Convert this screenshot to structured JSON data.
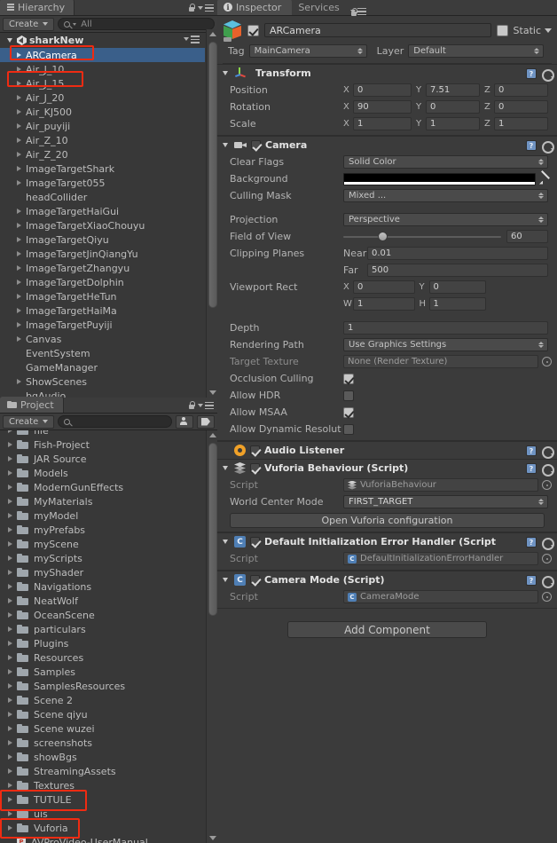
{
  "hierarchy": {
    "tab_label": "Hierarchy",
    "tab_icon": "hierarchy-icon",
    "create_label": "Create",
    "search_placeholder": "All",
    "search_value": "All",
    "scene_name": "sharkNew",
    "items": [
      {
        "label": "ARCamera",
        "expandable": true,
        "selected": true,
        "highlighted": true
      },
      {
        "label": "Air_J_10",
        "expandable": true,
        "selected": false,
        "highlighted": false
      },
      {
        "label": "Air_J_15",
        "expandable": true,
        "selected": false,
        "highlighted": true
      },
      {
        "label": "Air_J_20",
        "expandable": true,
        "selected": false,
        "highlighted": false
      },
      {
        "label": "Air_KJ500",
        "expandable": true,
        "selected": false,
        "highlighted": false
      },
      {
        "label": "Air_puyiji",
        "expandable": true,
        "selected": false,
        "highlighted": false
      },
      {
        "label": "Air_Z_10",
        "expandable": true,
        "selected": false,
        "highlighted": false
      },
      {
        "label": "Air_Z_20",
        "expandable": true,
        "selected": false,
        "highlighted": false
      },
      {
        "label": "ImageTargetShark",
        "expandable": true,
        "selected": false,
        "highlighted": false
      },
      {
        "label": "ImageTarget055",
        "expandable": true,
        "selected": false,
        "highlighted": false
      },
      {
        "label": "headCollider",
        "expandable": false,
        "selected": false,
        "highlighted": false
      },
      {
        "label": "ImageTargetHaiGui",
        "expandable": true,
        "selected": false,
        "highlighted": false
      },
      {
        "label": "ImageTargetXiaoChouyu",
        "expandable": true,
        "selected": false,
        "highlighted": false
      },
      {
        "label": "ImageTargetQiyu",
        "expandable": true,
        "selected": false,
        "highlighted": false
      },
      {
        "label": "ImageTargetJinQiangYu",
        "expandable": true,
        "selected": false,
        "highlighted": false
      },
      {
        "label": "ImageTargetZhangyu",
        "expandable": true,
        "selected": false,
        "highlighted": false
      },
      {
        "label": "ImageTargetDolphin",
        "expandable": true,
        "selected": false,
        "highlighted": false
      },
      {
        "label": "ImageTargetHeTun",
        "expandable": true,
        "selected": false,
        "highlighted": false
      },
      {
        "label": "ImageTargetHaiMa",
        "expandable": true,
        "selected": false,
        "highlighted": false
      },
      {
        "label": "ImageTargetPuyiji",
        "expandable": true,
        "selected": false,
        "highlighted": false
      },
      {
        "label": "Canvas",
        "expandable": true,
        "selected": false,
        "highlighted": false
      },
      {
        "label": "EventSystem",
        "expandable": false,
        "selected": false,
        "highlighted": false
      },
      {
        "label": "GameManager",
        "expandable": false,
        "selected": false,
        "highlighted": false
      },
      {
        "label": "ShowScenes",
        "expandable": true,
        "selected": false,
        "highlighted": false
      },
      {
        "label": "bqAudio",
        "expandable": false,
        "selected": false,
        "highlighted": false
      }
    ]
  },
  "project": {
    "tab_label": "Project",
    "tab_icon": "folder-icon",
    "create_label": "Create",
    "search_placeholder": "",
    "items": [
      {
        "label": "file",
        "icon": "folder-icon",
        "expandable": true,
        "highlighted": false,
        "clipped": true
      },
      {
        "label": "Fish-Project",
        "icon": "folder-icon",
        "expandable": true,
        "highlighted": false
      },
      {
        "label": "JAR Source",
        "icon": "folder-icon",
        "expandable": true,
        "highlighted": false
      },
      {
        "label": "Models",
        "icon": "folder-icon",
        "expandable": true,
        "highlighted": false
      },
      {
        "label": "ModernGunEffects",
        "icon": "folder-icon",
        "expandable": true,
        "highlighted": false
      },
      {
        "label": "MyMaterials",
        "icon": "folder-icon",
        "expandable": true,
        "highlighted": false
      },
      {
        "label": "myModel",
        "icon": "folder-icon",
        "expandable": true,
        "highlighted": false
      },
      {
        "label": "myPrefabs",
        "icon": "folder-icon",
        "expandable": true,
        "highlighted": false
      },
      {
        "label": "myScene",
        "icon": "folder-icon",
        "expandable": true,
        "highlighted": false
      },
      {
        "label": "myScripts",
        "icon": "folder-icon",
        "expandable": true,
        "highlighted": false
      },
      {
        "label": "myShader",
        "icon": "folder-icon",
        "expandable": true,
        "highlighted": false
      },
      {
        "label": "Navigations",
        "icon": "folder-icon",
        "expandable": true,
        "highlighted": false
      },
      {
        "label": "NeatWolf",
        "icon": "folder-icon",
        "expandable": true,
        "highlighted": false
      },
      {
        "label": "OceanScene",
        "icon": "folder-icon",
        "expandable": true,
        "highlighted": false
      },
      {
        "label": "particulars",
        "icon": "folder-icon",
        "expandable": true,
        "highlighted": false
      },
      {
        "label": "Plugins",
        "icon": "folder-icon",
        "expandable": true,
        "highlighted": false
      },
      {
        "label": "Resources",
        "icon": "folder-icon",
        "expandable": true,
        "highlighted": false
      },
      {
        "label": "Samples",
        "icon": "folder-icon",
        "expandable": true,
        "highlighted": false
      },
      {
        "label": "SamplesResources",
        "icon": "folder-icon",
        "expandable": true,
        "highlighted": false
      },
      {
        "label": "Scene 2",
        "icon": "folder-icon",
        "expandable": true,
        "highlighted": false
      },
      {
        "label": "Scene qiyu",
        "icon": "folder-icon",
        "expandable": true,
        "highlighted": false
      },
      {
        "label": "Scene wuzei",
        "icon": "folder-icon",
        "expandable": true,
        "highlighted": false
      },
      {
        "label": "screenshots",
        "icon": "folder-icon",
        "expandable": true,
        "highlighted": false
      },
      {
        "label": "showBgs",
        "icon": "folder-icon",
        "expandable": true,
        "highlighted": false
      },
      {
        "label": "StreamingAssets",
        "icon": "folder-icon",
        "expandable": true,
        "highlighted": false
      },
      {
        "label": "Textures",
        "icon": "folder-icon",
        "expandable": true,
        "highlighted": false
      },
      {
        "label": "TUTULE",
        "icon": "folder-icon",
        "expandable": true,
        "highlighted": true
      },
      {
        "label": "uis",
        "icon": "folder-icon",
        "expandable": true,
        "highlighted": false
      },
      {
        "label": "Vuforia",
        "icon": "folder-icon",
        "expandable": true,
        "highlighted": true
      },
      {
        "label": "AVProVideo-UserManual",
        "icon": "pdf-icon",
        "expandable": false,
        "highlighted": false
      }
    ]
  },
  "inspector": {
    "tabs": [
      {
        "label": "Inspector",
        "active": true,
        "icon": "info-icon"
      },
      {
        "label": "Services",
        "active": false,
        "icon": ""
      }
    ],
    "object": {
      "name": "ARCamera",
      "enabled": true,
      "static_label": "Static",
      "static_checked": false,
      "tag_label": "Tag",
      "tag_value": "MainCamera",
      "layer_label": "Layer",
      "layer_value": "Default"
    },
    "components": [
      {
        "title": "Transform",
        "icon": "transform-axis-icon",
        "has_checkbox": false,
        "rows": [
          {
            "name": "Position",
            "type": "vector3",
            "x": "0",
            "y": "7.51",
            "z": "0"
          },
          {
            "name": "Rotation",
            "type": "vector3",
            "x": "90",
            "y": "0",
            "z": "0"
          },
          {
            "name": "Scale",
            "type": "vector3",
            "x": "1",
            "y": "1",
            "z": "1"
          }
        ]
      },
      {
        "title": "Camera",
        "icon": "camera-icon",
        "has_checkbox": true,
        "checked": true,
        "rows": [
          {
            "name": "Clear Flags",
            "type": "dropdown",
            "value": "Solid Color"
          },
          {
            "name": "Background",
            "type": "color",
            "value": "#000000"
          },
          {
            "name": "Culling Mask",
            "type": "dropdown",
            "value": "Mixed ..."
          },
          {
            "name": "",
            "type": "spacer"
          },
          {
            "name": "Projection",
            "type": "dropdown",
            "value": "Perspective"
          },
          {
            "name": "Field of View",
            "type": "slider",
            "value": "60",
            "percent": 22
          },
          {
            "name": "Clipping Planes",
            "type": "sub",
            "sub_label": "Near",
            "value": "0.01"
          },
          {
            "name": "",
            "type": "sub",
            "sub_label": "Far",
            "value": "500"
          },
          {
            "name": "Viewport Rect",
            "type": "vector2",
            "a_label": "X",
            "a": "0",
            "b_label": "Y",
            "b": "0"
          },
          {
            "name": "",
            "type": "vector2",
            "a_label": "W",
            "a": "1",
            "b_label": "H",
            "b": "1"
          },
          {
            "name": "",
            "type": "spacer"
          },
          {
            "name": "Depth",
            "type": "text",
            "value": "1"
          },
          {
            "name": "Rendering Path",
            "type": "dropdown",
            "value": "Use Graphics Settings"
          },
          {
            "name": "Target Texture",
            "type": "object",
            "value": "None (Render Texture)"
          },
          {
            "name": "Occlusion Culling",
            "type": "checkbox",
            "checked": true
          },
          {
            "name": "Allow HDR",
            "type": "checkbox",
            "checked": false
          },
          {
            "name": "Allow MSAA",
            "type": "checkbox",
            "checked": true
          },
          {
            "name": "Allow Dynamic Resolut",
            "type": "checkbox",
            "checked": false
          }
        ]
      },
      {
        "title": "Audio Listener",
        "icon": "audio-listener-icon",
        "has_checkbox": true,
        "checked": true,
        "collapsed": true,
        "rows": []
      },
      {
        "title": "Vuforia Behaviour (Script)",
        "icon": "vuforia-icon",
        "has_checkbox": true,
        "checked": true,
        "rows": [
          {
            "name": "Script",
            "type": "object-ref",
            "value": "VuforiaBehaviour",
            "ref_icon": "vuforia-icon"
          },
          {
            "name": "World Center Mode",
            "type": "dropdown",
            "value": "FIRST_TARGET"
          }
        ],
        "button": "Open Vuforia configuration"
      },
      {
        "title": "Default Initialization Error Handler (Script",
        "icon": "csharp-icon",
        "has_checkbox": true,
        "checked": true,
        "rows": [
          {
            "name": "Script",
            "type": "object-ref",
            "value": "DefaultInitializationErrorHandler",
            "ref_icon": "csharp-icon"
          }
        ]
      },
      {
        "title": "Camera Mode (Script)",
        "icon": "csharp-icon",
        "has_checkbox": true,
        "checked": true,
        "rows": [
          {
            "name": "Script",
            "type": "object-ref",
            "value": "CameraMode",
            "ref_icon": "csharp-icon"
          }
        ]
      }
    ],
    "add_component_label": "Add Component"
  },
  "colors": {
    "selection_blue": "#3a5f8a",
    "annotation_red": "#ef2b12",
    "panel_bg": "#383838",
    "inspector_bg": "#3b3b3b"
  }
}
